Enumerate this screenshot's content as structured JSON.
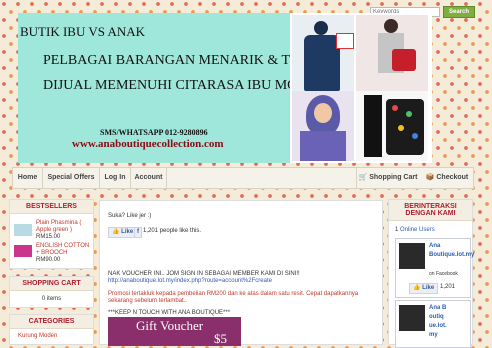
{
  "search": {
    "placeholder": "Keywords",
    "button": "Search"
  },
  "banner": {
    "line1": "BUTIK IBU VS ANAK",
    "line2": "PELBAGAI BARANGAN MENARIK & TRENDY",
    "line3": "DIJUAL MEMENUHI CITARASA IBU MODERN",
    "contact": "SMS/WHATSAPP 012-9280896",
    "website": "www.anaboutiquecollection.com"
  },
  "nav": {
    "items": [
      "Home",
      "Special Offers",
      "Log In",
      "Account"
    ],
    "cart": "Shopping Cart",
    "checkout": "Checkout",
    "cart_icon": "cart-icon",
    "checkout_icon": "checkout-icon"
  },
  "bestsellers": {
    "title": "BESTSELLERS",
    "items": [
      {
        "name": "Plain Phasmina ( Apple green )",
        "price": "RM15.00"
      },
      {
        "name": "ENGLISH COTTON + BROOCH",
        "price": "RM90.00"
      }
    ]
  },
  "cart": {
    "title": "SHOPPING CART",
    "text": "0 items"
  },
  "categories": {
    "title": "CATEGORIES",
    "first": "Kurung Moden"
  },
  "content": {
    "like_prompt": "Suka? Like jer :)",
    "like_button": "Like",
    "share_button": "Share",
    "like_count": "1,201 people like this.",
    "voucher_msg": "NAK VOUCHER INI.. JOM SIGN IN SEBAGAI MEMBER KAMI DI SINI!!",
    "voucher_link": "http://anaboutique.lot.my/index.php?route=account%2Fcreate",
    "promo": "Promosi tertakluk kepada pembelian RM200 dan ke atas dalam satu resit. Cepat dapatkannya",
    "promo2": "sekarang sebelum terlambat..",
    "keep": "***KEEP N TOUCH WITH ANA BOUTIQUE***",
    "voucher_title": "Gift Voucher",
    "voucher_amount": "$5"
  },
  "right": {
    "title": "BERINTERAKSI DENGAN KAMI",
    "online_count": "1",
    "online_label": "Online Users",
    "fb1": {
      "name": "Ana Boutique.lot.my",
      "sub": "on Facebook",
      "like": "Like",
      "count": "1,201"
    },
    "fb2": {
      "name": "Ana Boutique.lot.my"
    }
  },
  "colors": {
    "accent": "#b01e2c",
    "search": "#7fae3f",
    "banner": "#9fe7da",
    "link": "#2c5fb3"
  }
}
